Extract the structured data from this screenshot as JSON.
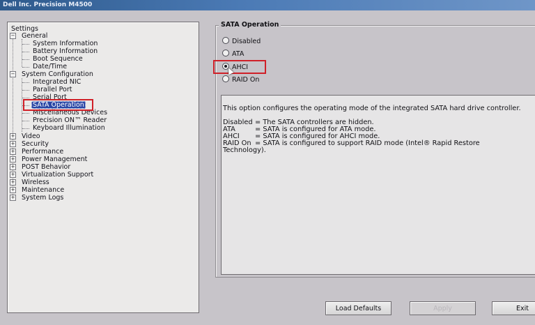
{
  "window": {
    "title": "Dell Inc. Precision M4500"
  },
  "tree": {
    "root": "Settings",
    "items": [
      {
        "label": "General",
        "level": 1,
        "expanded": true
      },
      {
        "label": "System Information",
        "level": 2
      },
      {
        "label": "Battery Information",
        "level": 2
      },
      {
        "label": "Boot Sequence",
        "level": 2
      },
      {
        "label": "Date/Time",
        "level": 2
      },
      {
        "label": "System Configuration",
        "level": 1,
        "expanded": true
      },
      {
        "label": "Integrated NIC",
        "level": 2
      },
      {
        "label": "Parallel Port",
        "level": 2
      },
      {
        "label": "Serial Port",
        "level": 2
      },
      {
        "label": "SATA Operation",
        "level": 2,
        "selected": true
      },
      {
        "label": "Miscellaneous Devices",
        "level": 2
      },
      {
        "label": "Precision ON™ Reader",
        "level": 2
      },
      {
        "label": "Keyboard Illumination",
        "level": 2
      },
      {
        "label": "Video",
        "level": 1
      },
      {
        "label": "Security",
        "level": 1
      },
      {
        "label": "Performance",
        "level": 1
      },
      {
        "label": "Power Management",
        "level": 1
      },
      {
        "label": "POST Behavior",
        "level": 1
      },
      {
        "label": "Virtualization Support",
        "level": 1
      },
      {
        "label": "Wireless",
        "level": 1
      },
      {
        "label": "Maintenance",
        "level": 1
      },
      {
        "label": "System Logs",
        "level": 1
      }
    ]
  },
  "sata": {
    "group_title": "SATA Operation",
    "options": [
      {
        "label": "Disabled",
        "checked": false
      },
      {
        "label": "ATA",
        "checked": false
      },
      {
        "label": "AHCI",
        "checked": true
      },
      {
        "label": "RAID On",
        "checked": false
      }
    ]
  },
  "help": {
    "intro": "This option configures the operating mode of the integrated SATA hard drive controller.",
    "rows": [
      {
        "key": "Disabled",
        "desc": "= The SATA controllers are hidden."
      },
      {
        "key": "ATA",
        "desc": "= SATA is configured for ATA mode."
      },
      {
        "key": "AHCI",
        "desc": "= SATA is configured for AHCI mode."
      },
      {
        "key": "RAID On",
        "desc": "= SATA is configured to support RAID mode (Intel® Rapid Restore"
      }
    ],
    "continuation": "Technology)."
  },
  "buttons": {
    "load_defaults": "Load Defaults",
    "apply": "Apply",
    "exit": "Exit"
  },
  "colors": {
    "selection": "#2a47a6",
    "highlight_box": "#d02028",
    "titlebar": "#2e5a8c"
  }
}
